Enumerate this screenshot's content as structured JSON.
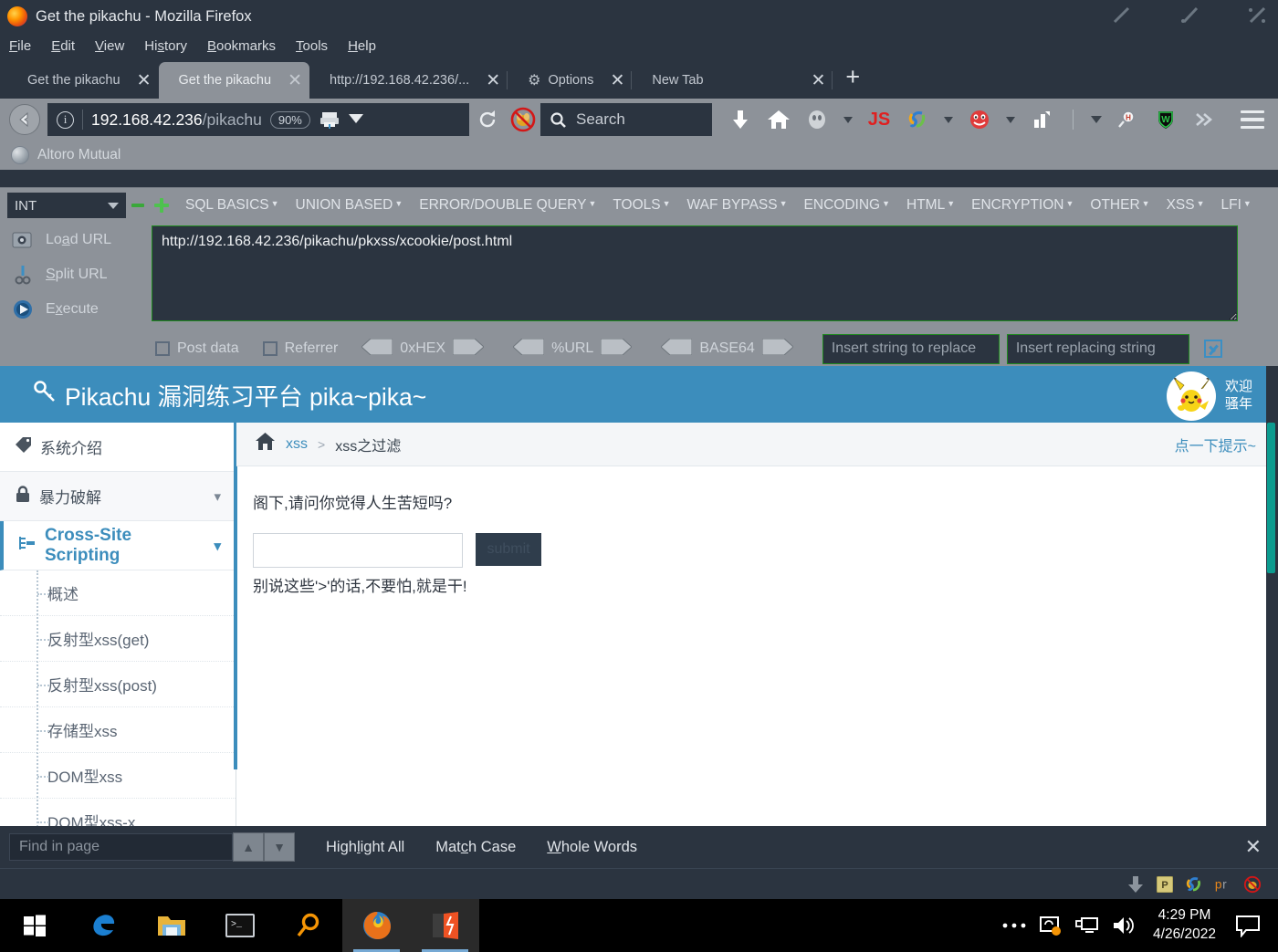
{
  "window": {
    "title": "Get the pikachu - Mozilla Firefox",
    "minimize_icon": "minimize-icon",
    "maximize_icon": "maximize-icon",
    "close_icon": "close-icon"
  },
  "menubar": [
    {
      "label": "File",
      "accel": "F"
    },
    {
      "label": "Edit",
      "accel": "E"
    },
    {
      "label": "View",
      "accel": "V"
    },
    {
      "label": "History",
      "accel": "s"
    },
    {
      "label": "Bookmarks",
      "accel": "B"
    },
    {
      "label": "Tools",
      "accel": "T"
    },
    {
      "label": "Help",
      "accel": "H"
    }
  ],
  "tabs": [
    {
      "label": "Get the pikachu",
      "active": false,
      "icon": ""
    },
    {
      "label": "Get the pikachu",
      "active": true,
      "icon": ""
    },
    {
      "label": "http://192.168.42.236/...",
      "active": false,
      "icon": ""
    },
    {
      "label": "Options",
      "active": false,
      "icon": "gear-icon"
    },
    {
      "label": "New Tab",
      "active": false,
      "icon": ""
    }
  ],
  "newtab_label": "+",
  "navbar": {
    "url_host": "192.168.42.236",
    "url_path": "/pikachu",
    "zoom": "90%",
    "search_placeholder": "Search",
    "icons": [
      "download-icon",
      "home-icon",
      "ghost-icon",
      "js-icon",
      "s-swirl-icon",
      "red-smiley-icon",
      "chart-icon",
      "dropdown-caret-icon",
      "magnifier-h-icon",
      "shield-w-icon",
      "chevrons-right-icon",
      "hamburger-menu-icon"
    ]
  },
  "bookmarks": [
    {
      "label": "Altoro Mutual",
      "icon": "globe-icon"
    }
  ],
  "hackbar": {
    "type_select": "INT",
    "remove_label": "-",
    "add_label": "+",
    "menus": [
      "SQL BASICS",
      "UNION BASED",
      "ERROR/DOUBLE QUERY",
      "TOOLS",
      "WAF BYPASS",
      "ENCODING",
      "HTML",
      "ENCRYPTION",
      "OTHER",
      "XSS",
      "LFI"
    ],
    "buttons": [
      {
        "label": "Load URL",
        "accel": "a",
        "icon": "load-url-icon"
      },
      {
        "label": "Split URL",
        "accel": "S",
        "icon": "scissors-icon"
      },
      {
        "label": "Execute",
        "accel": "x",
        "icon": "play-icon"
      }
    ],
    "url_value": "http://192.168.42.236/pikachu/pkxss/xcookie/post.html",
    "checkboxes": [
      {
        "label": "Post data",
        "checked": false
      },
      {
        "label": "Referrer",
        "checked": false
      }
    ],
    "encoders": [
      "0xHEX",
      "%URL",
      "BASE64"
    ],
    "replace_placeholder": "Insert string to replace",
    "replacing_placeholder": "Insert replacing string"
  },
  "pikachu": {
    "brand": "Pikachu 漏洞练习平台 pika~pika~",
    "brand_icon": "key-icon",
    "avatar_icon": "pikachu-avatar",
    "welcome_line1": "欢迎",
    "welcome_line2": "骚年",
    "accent_color": "#3c8dbc",
    "sidebar": [
      {
        "label": "系统介绍",
        "icon": "tag-icon",
        "type": "plain",
        "expandable": false
      },
      {
        "label": "暴力破解",
        "icon": "lock-icon",
        "type": "group",
        "expandable": true
      },
      {
        "label": "Cross-Site Scripting",
        "icon": "xss-icon",
        "type": "group",
        "expandable": true,
        "active": true
      },
      {
        "label": "概述",
        "type": "sub"
      },
      {
        "label": "反射型xss(get)",
        "type": "sub"
      },
      {
        "label": "反射型xss(post)",
        "type": "sub"
      },
      {
        "label": "存储型xss",
        "type": "sub"
      },
      {
        "label": "DOM型xss",
        "type": "sub"
      },
      {
        "label": "DOM型xss-x",
        "type": "sub"
      }
    ],
    "breadcrumb": {
      "home_icon": "home-icon",
      "parent": "xss",
      "separator": ">",
      "current": "xss之过滤",
      "hint_link": "点一下提示~"
    },
    "content": {
      "question": "阁下,请问你觉得人生苦短吗?",
      "input_value": "",
      "submit_label": "submit",
      "note": "别说这些'>'的话,不要怕,就是干!"
    }
  },
  "findbar": {
    "placeholder": "Find in page",
    "value": "",
    "prev_icon": "chevron-up-icon",
    "next_icon": "chevron-down-icon",
    "actions": [
      {
        "label": "Highlight All",
        "accel": "l"
      },
      {
        "label": "Match Case",
        "accel": "c"
      },
      {
        "label": "Whole Words",
        "accel": "W"
      }
    ],
    "close_icon": "close-icon"
  },
  "traystrip": {
    "icons": [
      "download-arrow-icon",
      "p-box-icon",
      "s-swirl-icon",
      "pr-icon",
      "noscript-icon"
    ]
  },
  "taskbar": {
    "items": [
      {
        "icon": "windows-start-icon",
        "active": false
      },
      {
        "icon": "edge-icon",
        "active": false
      },
      {
        "icon": "file-explorer-icon",
        "active": false
      },
      {
        "icon": "terminal-icon",
        "active": false
      },
      {
        "icon": "search-magnifier-icon",
        "active": false
      },
      {
        "icon": "firefox-icon",
        "active": true
      },
      {
        "icon": "burp-suite-icon",
        "active": true
      }
    ],
    "tray_icons": [
      "overflow-dots-icon",
      "update-icon",
      "network-icon",
      "volume-icon"
    ],
    "clock_time": "4:29 PM",
    "clock_date": "4/26/2022",
    "notification_icon": "notification-icon"
  }
}
